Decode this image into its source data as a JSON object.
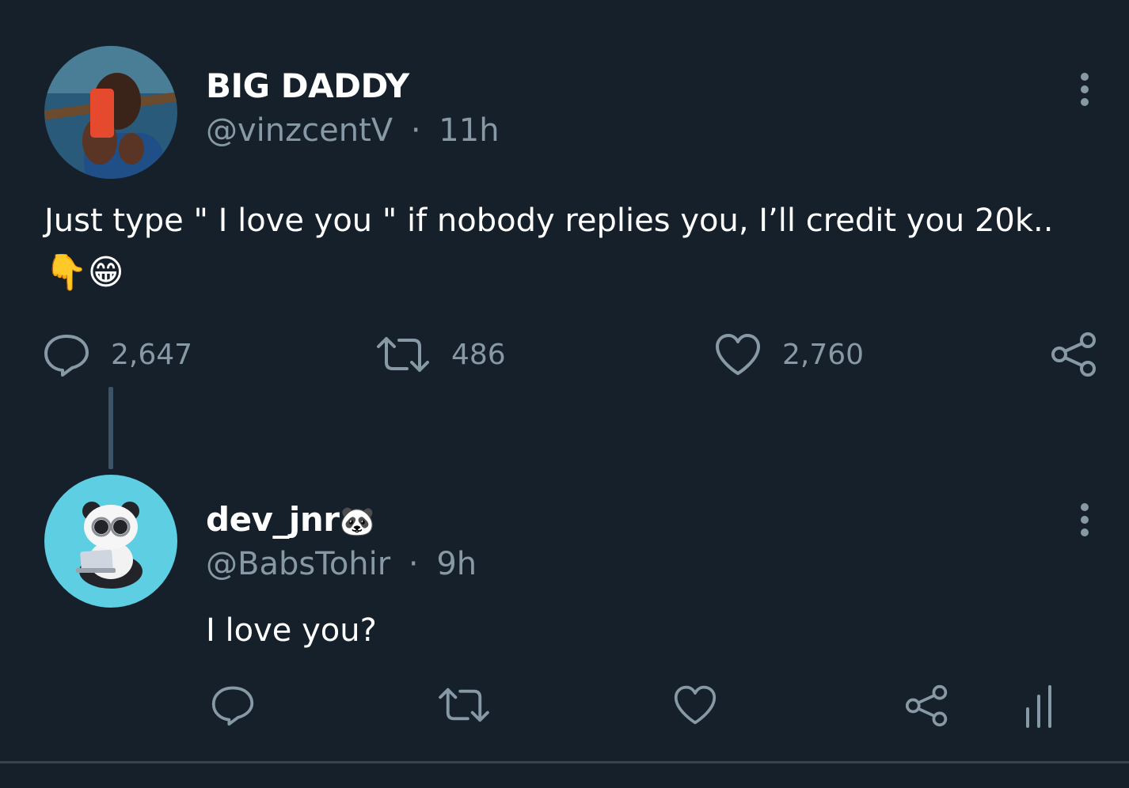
{
  "colors": {
    "background": "#15202b",
    "text_primary": "#ffffff",
    "text_secondary": "#8899a6",
    "thread_line": "#3d5466",
    "divider": "#38444d"
  },
  "main_tweet": {
    "name": "BIG DADDY",
    "handle": "@vinzcentV",
    "separator": "·",
    "time": "11h",
    "text_line1": "Just type \" I love you \" if nobody replies you, I’ll credit you 20k..",
    "emoji": "👇😁",
    "avatar_icon": "profile-photo-selfie",
    "actions": {
      "reply_count": "2,647",
      "retweet_count": "486",
      "like_count": "2,760"
    }
  },
  "reply_tweet": {
    "name": "dev_jnr",
    "name_emoji": "🐼",
    "handle": "@BabsTohir",
    "separator": "·",
    "time": "9h",
    "text": "I love you?",
    "avatar_icon": "panda-with-laptop"
  }
}
